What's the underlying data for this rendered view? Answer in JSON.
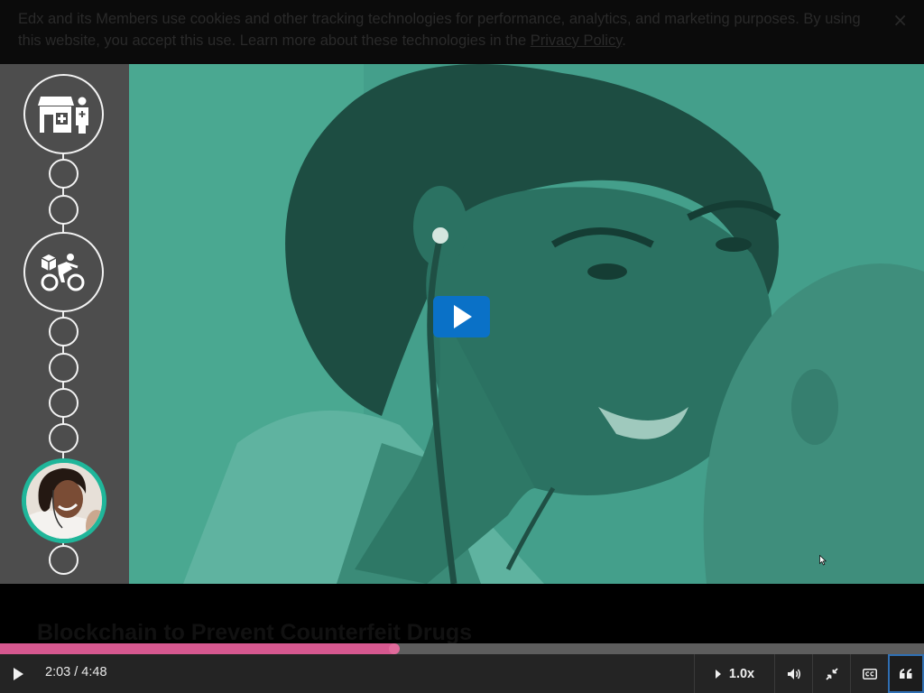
{
  "cookie_banner": {
    "text": "Edx and its Members use cookies and other tracking technologies for performance, analytics, and marketing purposes. By using this website, you accept this use. Learn more about these technologies in the ",
    "link_text": "Privacy Policy",
    "after_link": ".",
    "close_symbol": "×"
  },
  "video": {
    "title": "Blockchain to Prevent Counterfeit Drugs",
    "current_time": "2:03",
    "duration": "4:48",
    "time_display": "2:03 / 4:48",
    "progress_fraction": 0.427,
    "speed": "1.0x"
  },
  "sidebar_timeline": {
    "nodes": [
      "pharmacy-doctor-icon",
      "step",
      "step",
      "delivery-cyclist-icon",
      "step",
      "step",
      "step",
      "step",
      "doctor-photo-active",
      "step"
    ]
  },
  "colors": {
    "accent_teal": "#1fb69a",
    "progress_pink": "#d5588f",
    "play_blue": "#0a71c7",
    "video_tint": "#3f9a86"
  }
}
